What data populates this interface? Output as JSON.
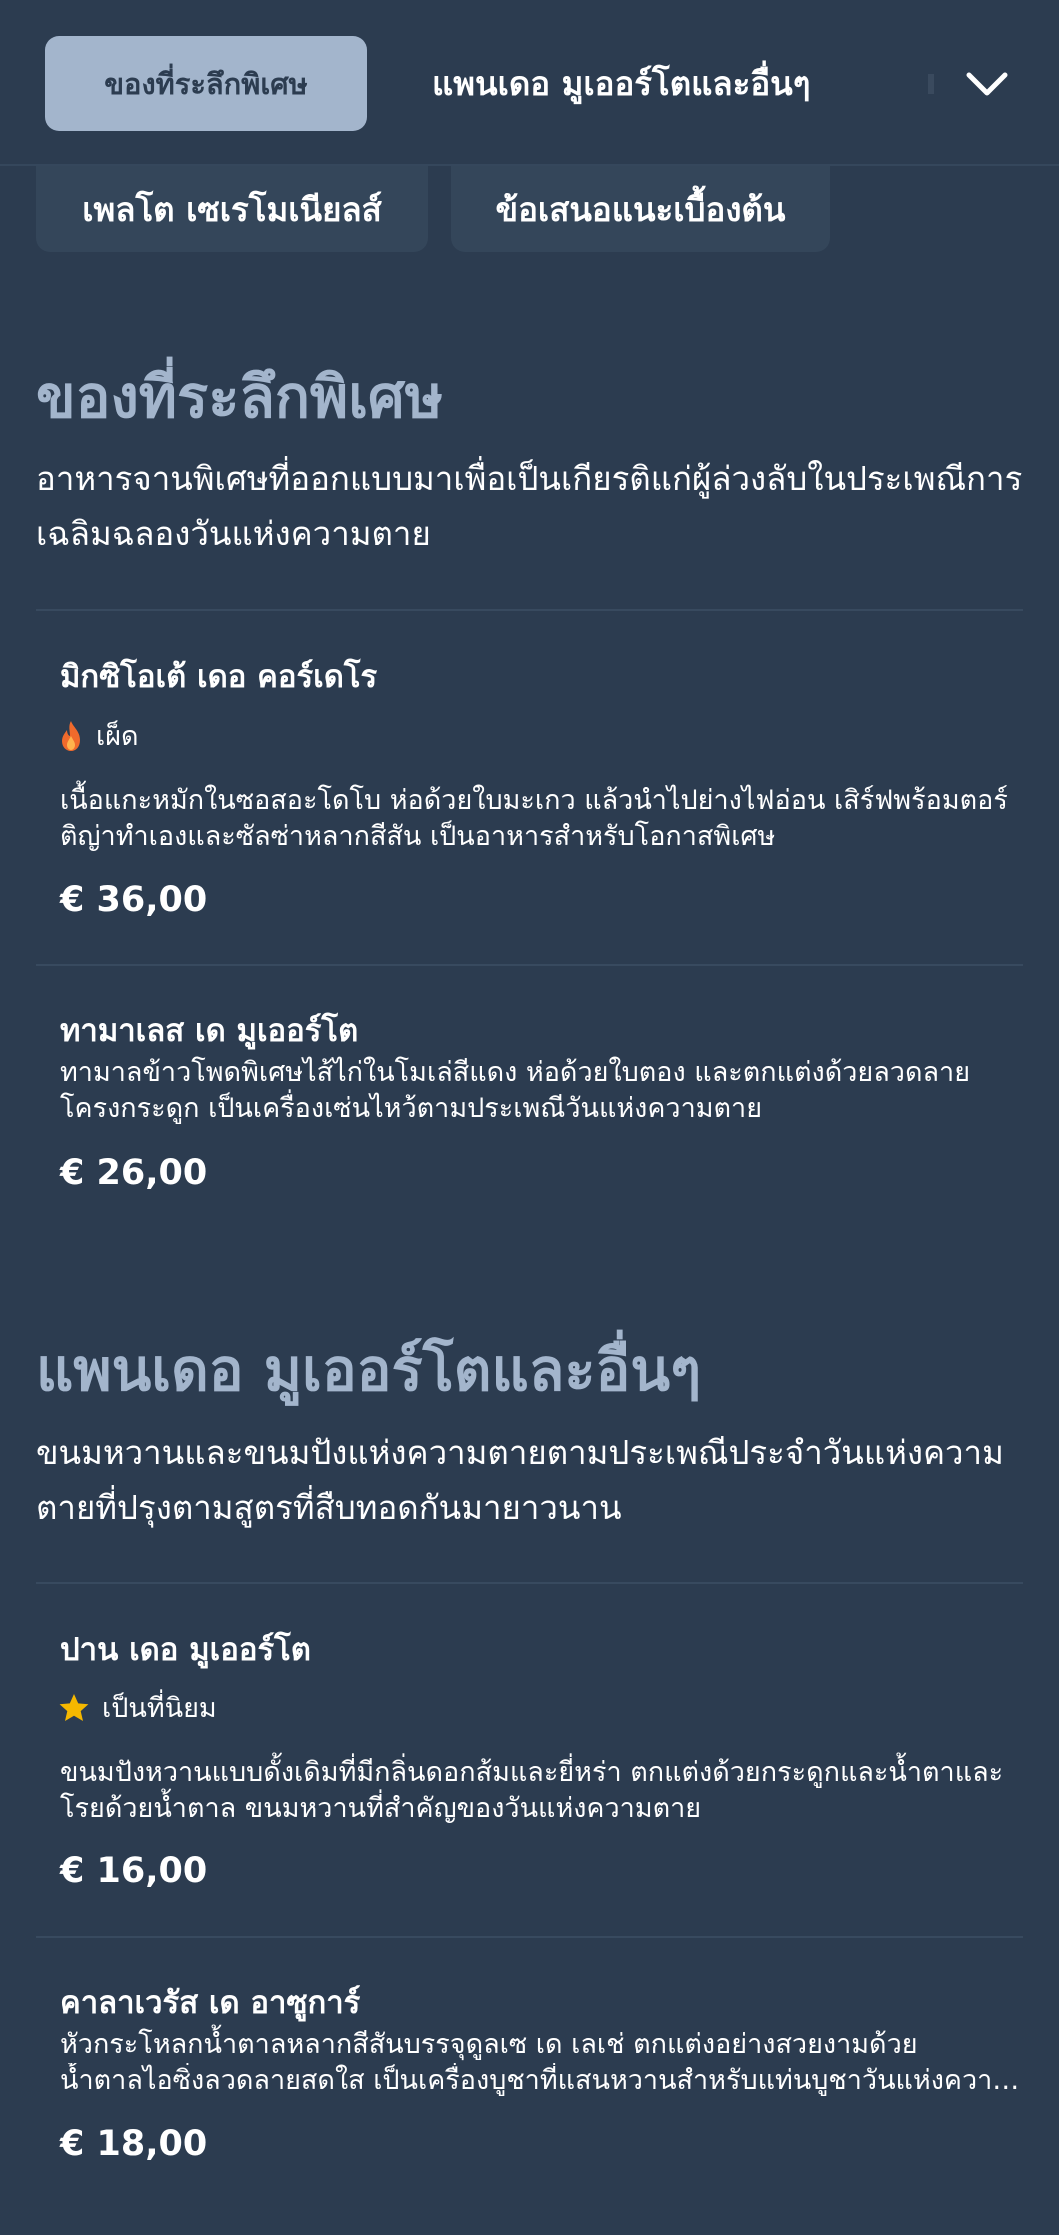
{
  "nav": {
    "tabs": [
      {
        "label": "ของที่ระลึกพิเศษ",
        "active": true
      },
      {
        "label": "แพนเดอ มูเออร์โตและอื่นๆ",
        "active": false
      }
    ],
    "subtabs": [
      {
        "label": "เพลโต เซเรโมเนียลส์"
      },
      {
        "label": "ข้อเสนอแนะเบื้องต้น"
      }
    ],
    "expand_icon": "chevron-down-icon"
  },
  "sections": [
    {
      "title": "ของที่ระลึกพิเศษ",
      "description": "อาหารจานพิเศษที่ออกแบบมาเพื่อเป็นเกียรติแก่ผู้ล่วงลับในประเพณีการเฉลิมฉลองวันแห่งความตาย",
      "items": [
        {
          "name": "มิกซิโอเต้ เดอ คอร์เดโร",
          "tag": "เผ็ด",
          "tag_icon": "flame-icon",
          "description": "เนื้อแกะหมักในซอสอะโดโบ ห่อด้วยใบมะเกว แล้วนำไปย่างไฟอ่อน เสิร์ฟพร้อมตอร์ติญ่าทำเองและซัลซ่าหลากสีสัน เป็นอาหารสำหรับโอกาสพิเศษ",
          "price": "€ 36,00"
        },
        {
          "name": "ทามาเลส เด มูเออร์โต",
          "description": "ทามาลข้าวโพดพิเศษไส้ไก่ในโมเล่สีแดง ห่อด้วยใบตอง และตกแต่งด้วยลวดลายโครงกระดูก เป็นเครื่องเซ่นไหว้ตามประเพณีวันแห่งความตาย",
          "price": "€ 26,00"
        }
      ]
    },
    {
      "title": "แพนเดอ มูเออร์โตและอื่นๆ",
      "description": "ขนมหวานและขนมปังแห่งความตายตามประเพณีประจำวันแห่งความตายที่ปรุงตามสูตรที่สืบทอดกันมายาวนาน",
      "items": [
        {
          "name": "ปาน เดอ มูเออร์โต",
          "tag": "เป็นที่นิยม",
          "tag_icon": "star-icon",
          "description": "ขนมปังหวานแบบดั้งเดิมที่มีกลิ่นดอกส้มและยี่หร่า ตกแต่งด้วยกระดูกและน้ำตาและโรยด้วยน้ำตาล ขนมหวานที่สำคัญของวันแห่งความตาย",
          "price": "€ 16,00"
        },
        {
          "name": "คาลาเวรัส เด อาซูการ์",
          "description_line1": "หัวกระโหลกน้ำตาลหลากสีสันบรรจุดูลเซ เด เลเช่ ตกแต่งอย่างสวยงามด้วย",
          "description_line2": "น้ำตาลไอซิ่งลวดลายสดใส เป็นเครื่องบูชาที่แสนหวานสำหรับแท่นบูชาวันแห่งความตาย",
          "price": "€ 18,00"
        }
      ]
    }
  ],
  "colors": {
    "background": "#2c3c50",
    "accent": "#a3b5cc",
    "card": "#34465a",
    "flame": "#f06a2c",
    "star": "#f5b800"
  }
}
